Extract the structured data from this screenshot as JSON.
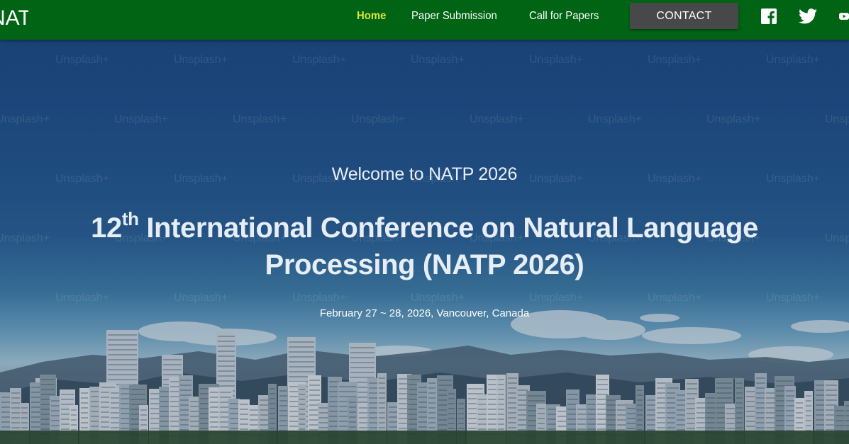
{
  "brand": {
    "text": "NATP"
  },
  "nav": {
    "home": "Home",
    "paper_submission": "Paper Submission",
    "call_for_papers": "Call for Papers",
    "contact": "CONTACT",
    "social": [
      "facebook-icon",
      "twitter-icon",
      "youtube-icon"
    ]
  },
  "colors": {
    "navbar_bg": "#006414",
    "active_link": "#d7e637",
    "contact_bg": "#48484a"
  },
  "hero": {
    "watermark": "Unsplash+",
    "welcome": "Welcome to NATP 2026",
    "title_prefix": "12",
    "title_ordinal": "th",
    "title_main": " International Conference on Natural Language",
    "title_line2": "Processing (NATP 2026)",
    "date_location": "February 27 ~ 28, 2026, Vancouver, Canada"
  }
}
